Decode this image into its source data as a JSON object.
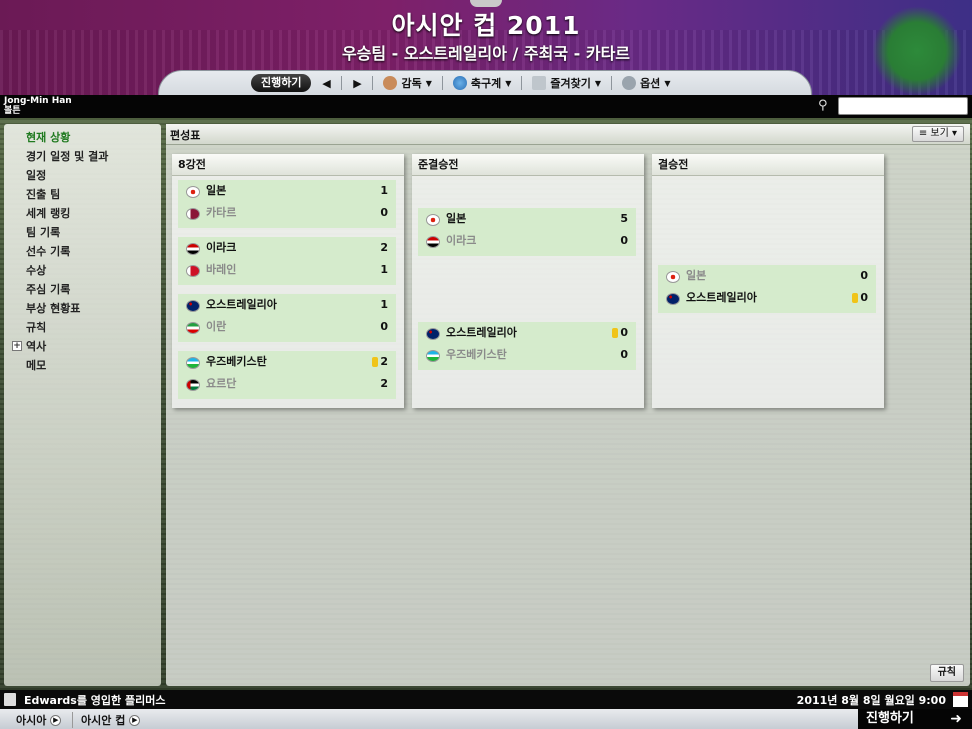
{
  "header": {
    "title": "아시안 컵 2011",
    "subtitle": "우승팀 - 오스트레일리아 / 주최국 - 카타르"
  },
  "toolbar": {
    "continue_label": "진행하기",
    "menus": [
      {
        "label": "감독",
        "icon": "manager-icon"
      },
      {
        "label": "축구계",
        "icon": "globe-icon"
      },
      {
        "label": "즐겨찾기",
        "icon": "bookmark-icon"
      },
      {
        "label": "옵션",
        "icon": "gear-icon"
      }
    ]
  },
  "user": {
    "name": "Jong-Min  Han",
    "club": "볼튼"
  },
  "sidebar": {
    "items": [
      {
        "label": "현재 상황",
        "active": true
      },
      {
        "label": "경기 일정 및 결과"
      },
      {
        "label": "일정"
      },
      {
        "label": "진출 팀"
      },
      {
        "label": "세계 랭킹"
      },
      {
        "label": "팀 기록"
      },
      {
        "label": "선수 기록"
      },
      {
        "label": "수상"
      },
      {
        "label": "주심 기록"
      },
      {
        "label": "부상 현황표"
      },
      {
        "label": "규칙"
      },
      {
        "label": "역사",
        "expandable": true
      },
      {
        "label": "메모"
      }
    ]
  },
  "main": {
    "title": "편성표",
    "view_label": "보기",
    "rules_label": "규칙",
    "rounds": [
      {
        "name": "8강전",
        "matches": [
          {
            "home": {
              "team": "일본",
              "score": "1",
              "winner": true
            },
            "away": {
              "team": "카타르",
              "score": "0",
              "winner": false
            }
          },
          {
            "home": {
              "team": "이라크",
              "score": "2",
              "winner": true
            },
            "away": {
              "team": "바레인",
              "score": "1",
              "winner": false
            }
          },
          {
            "home": {
              "team": "오스트레일리아",
              "score": "1",
              "winner": true
            },
            "away": {
              "team": "이란",
              "score": "0",
              "winner": false
            }
          },
          {
            "home": {
              "team": "우즈베키스탄",
              "score": "2",
              "winner": true,
              "penalty_marker": true
            },
            "away": {
              "team": "요르단",
              "score": "2",
              "winner": false
            }
          }
        ]
      },
      {
        "name": "준결승전",
        "matches": [
          {
            "home": {
              "team": "일본",
              "score": "5",
              "winner": true
            },
            "away": {
              "team": "이라크",
              "score": "0",
              "winner": false
            }
          },
          {
            "home": {
              "team": "오스트레일리아",
              "score": "0",
              "winner": true,
              "penalty_marker": true
            },
            "away": {
              "team": "우즈베키스탄",
              "score": "0",
              "winner": false
            }
          }
        ]
      },
      {
        "name": "결승전",
        "matches": [
          {
            "home": {
              "team": "일본",
              "score": "0",
              "winner": false
            },
            "away": {
              "team": "오스트레일리아",
              "score": "0",
              "winner": true,
              "penalty_marker": true
            }
          }
        ]
      }
    ]
  },
  "footer": {
    "news": "Edwards를 영입한 플리머스",
    "date": "2011년 8월 8일 월요일 9:00",
    "breadcrumbs": [
      "아시아",
      "아시안 컵"
    ],
    "continue_label": "진행하기"
  },
  "colors": {
    "header_purple": "#7e2069",
    "match_green": "#d5ebcc",
    "active_green": "#1f7a1f"
  }
}
